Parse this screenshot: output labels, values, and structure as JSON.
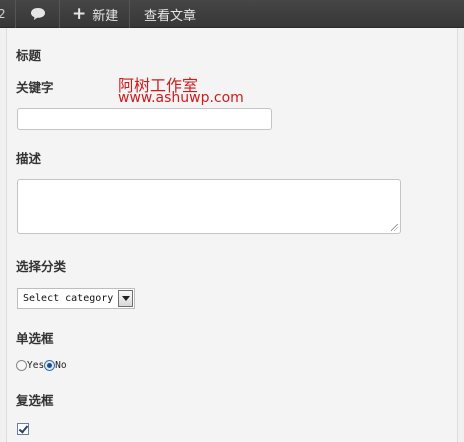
{
  "adminbar": {
    "count": "2",
    "new_label": "新建",
    "view_post_label": "查看文章",
    "icons": [
      "comment-icon",
      "plus-icon"
    ]
  },
  "form": {
    "title_label": "标题",
    "keywords_label": "关键字",
    "keywords_value": "",
    "description_label": "描述",
    "description_value": "",
    "category_label": "选择分类",
    "category_selected": "Select category",
    "radio_label": "单选框",
    "radio_options": [
      "Yes",
      "No"
    ],
    "radio_selected": "No",
    "checkbox_label": "复选框",
    "checkbox_checked": true
  },
  "watermark": {
    "name": "阿树工作室",
    "url": "www.ashuwp.com",
    "color": "#cc1c1c"
  }
}
